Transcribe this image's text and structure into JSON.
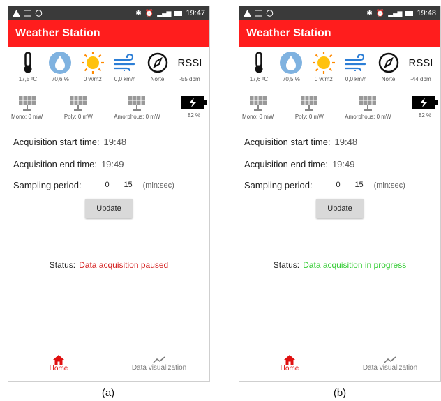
{
  "figure": {
    "caption_a": "(a)",
    "caption_b": "(b)"
  },
  "panel_a": {
    "statusbar": {
      "time": "19:47"
    },
    "app_title": "Weather Station",
    "sensors": {
      "temperature": "17,5 ºC",
      "humidity": "70,6 %",
      "irradiance": "0 w/m2",
      "wind_speed": "0,0 km/h",
      "wind_dir": "Norte",
      "rssi_label": "RSSI",
      "rssi_value": "-55 dbm"
    },
    "power": {
      "mono": "Mono: 0 mW",
      "poly": "Poly: 0 mW",
      "amorphous": "Amorphous: 0 mW",
      "battery": "82 %"
    },
    "acq_start_label": "Acquisition start time:",
    "acq_start_time": "19:48",
    "acq_end_label": "Acquisition end time:",
    "acq_end_time": "19:49",
    "sampling_label": "Sampling period:",
    "sampling_min": "0",
    "sampling_sec": "15",
    "sampling_unit": "(min:sec)",
    "update_label": "Update",
    "status_label": "Status:",
    "status_msg": "Data acquisition paused",
    "status_color": "#d42020",
    "nav_home": "Home",
    "nav_viz": "Data visualization"
  },
  "panel_b": {
    "statusbar": {
      "time": "19:48"
    },
    "app_title": "Weather Station",
    "sensors": {
      "temperature": "17,6 ºC",
      "humidity": "70,5 %",
      "irradiance": "0 w/m2",
      "wind_speed": "0,0 km/h",
      "wind_dir": "Norte",
      "rssi_label": "RSSI",
      "rssi_value": "-44 dbm"
    },
    "power": {
      "mono": "Mono: 0 mW",
      "poly": "Poly: 0 mW",
      "amorphous": "Amorphous: 0 mW",
      "battery": "82 %"
    },
    "acq_start_label": "Acquisition start time:",
    "acq_start_time": "19:48",
    "acq_end_label": "Acquisition end time:",
    "acq_end_time": "19:49",
    "sampling_label": "Sampling period:",
    "sampling_min": "0",
    "sampling_sec": "15",
    "sampling_unit": "(min:sec)",
    "update_label": "Update",
    "status_label": "Status:",
    "status_msg": "Data acquisition in progress",
    "status_color": "#33cc33",
    "nav_home": "Home",
    "nav_viz": "Data visualization"
  },
  "icons": {
    "thermometer": "thermometer-icon",
    "humidity": "water-drop-icon",
    "sun": "sun-icon",
    "wind": "wind-icon",
    "compass": "compass-icon",
    "solar_panel": "solar-panel-icon",
    "battery": "battery-charging-icon",
    "home": "home-icon",
    "chart": "chart-line-icon"
  },
  "colors": {
    "appbar": "#ff1d1d",
    "statusbar": "#3a3a3a",
    "home_active": "#e01010"
  }
}
